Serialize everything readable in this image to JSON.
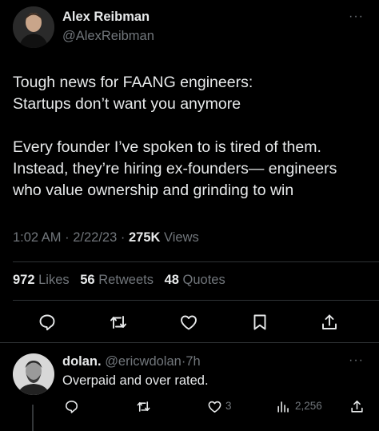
{
  "tweet": {
    "author_name": "Alex Reibman",
    "author_handle": "@AlexReibman",
    "lines": [
      "Tough news for FAANG engineers:",
      "Startups don’t want you anymore",
      "",
      "Every founder I’ve spoken to is tired of them.",
      "Instead, they’re hiring ex-founders— engineers",
      "who value ownership and grinding to win"
    ],
    "time": "1:02 AM",
    "date": "2/22/23",
    "separator": "·",
    "views_count": "275K",
    "views_label": "Views",
    "likes_count": "972",
    "likes_label": "Likes",
    "retweets_count": "56",
    "retweets_label": "Retweets",
    "quotes_count": "48",
    "quotes_label": "Quotes",
    "actions": [
      "reply-icon",
      "retweet-icon",
      "like-icon",
      "bookmark-icon",
      "share-icon"
    ]
  },
  "reply": {
    "author_name": "dolan.",
    "author_handle": "@ericwdolan",
    "separator": "·",
    "age": "7h",
    "text": "Overpaid and over rated.",
    "like_count": "3",
    "views_count": "2,256",
    "actions": [
      "reply-icon",
      "retweet-icon",
      "like-icon",
      "views-icon",
      "share-icon"
    ]
  },
  "more_label": "···",
  "colors": {
    "background": "#000000",
    "text": "#e7e9ea",
    "muted": "#71767b",
    "divider": "#2f3336"
  }
}
